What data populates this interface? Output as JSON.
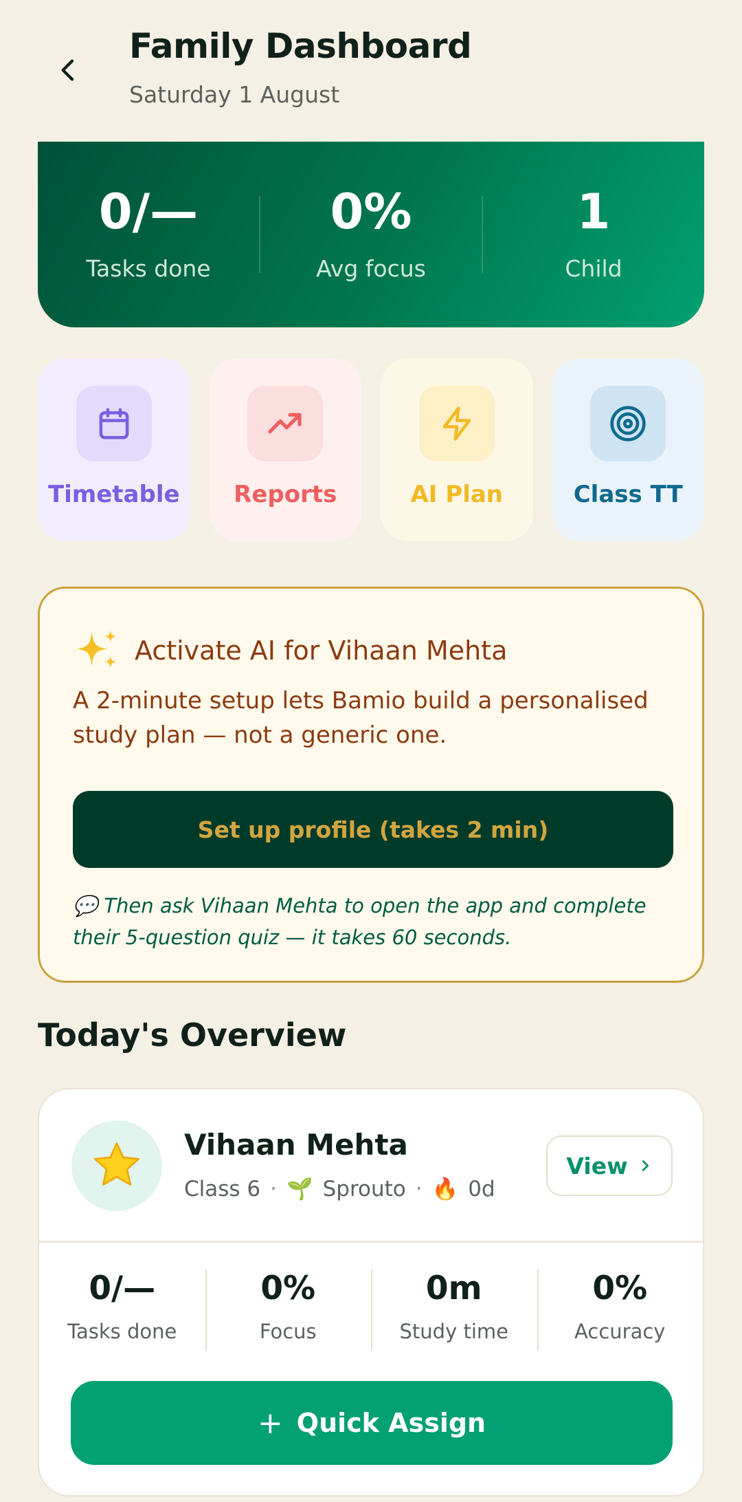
{
  "header": {
    "title": "Family Dashboard",
    "date": "Saturday 1 August"
  },
  "summary": {
    "tasks_done": {
      "value": "0/—",
      "label": "Tasks done"
    },
    "avg_focus": {
      "value": "0%",
      "label": "Avg focus"
    },
    "children": {
      "value": "1",
      "label": "Child"
    }
  },
  "tiles": [
    {
      "label": "Timetable",
      "icon": "calendar-icon",
      "color": "#7a5fe0"
    },
    {
      "label": "Reports",
      "icon": "trending-up-icon",
      "color": "#ee5f5f"
    },
    {
      "label": "AI Plan",
      "icon": "lightning-icon",
      "color": "#f0b925"
    },
    {
      "label": "Class TT",
      "icon": "target-icon",
      "color": "#0f6a8f"
    }
  ],
  "ai_card": {
    "icon": "sparkles-icon",
    "title": "Activate AI for Vihaan Mehta",
    "description": "A 2-minute setup lets Bamio build a personalised study plan — not a generic one.",
    "button_label": "Set up profile (takes 2 min)",
    "note_icon": "💬",
    "note": "Then ask Vihaan Mehta to open the app and complete their 5-question quiz — it takes 60 seconds."
  },
  "overview": {
    "section_title": "Today's Overview",
    "child": {
      "avatar_icon": "star-icon",
      "name": "Vihaan Mehta",
      "class": "Class 6",
      "level_icon": "🌱",
      "level": "Sprouto",
      "streak_icon": "🔥",
      "streak": "0d",
      "view_label": "View",
      "stats": [
        {
          "value": "0/—",
          "label": "Tasks done"
        },
        {
          "value": "0%",
          "label": "Focus"
        },
        {
          "value": "0m",
          "label": "Study time"
        },
        {
          "value": "0%",
          "label": "Accuracy"
        }
      ],
      "assign_label": "Quick Assign"
    }
  },
  "colors": {
    "background": "#f5f0e4",
    "brand_green": "#02a072",
    "dark_green": "#003b2a",
    "gold": "#c9a13e"
  }
}
